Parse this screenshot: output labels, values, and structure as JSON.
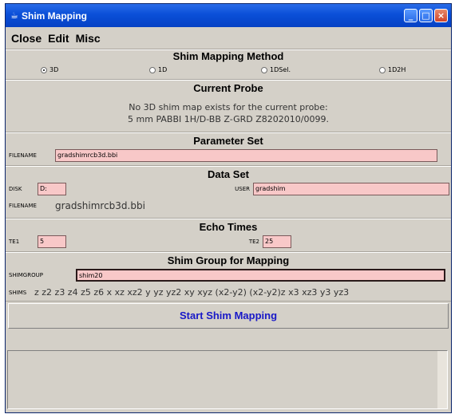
{
  "window": {
    "title": "Shim Mapping"
  },
  "menubar": {
    "items": [
      "Close",
      "Edit",
      "Misc"
    ]
  },
  "method": {
    "heading": "Shim Mapping Method",
    "options": [
      "3D",
      "1D",
      "1DSel.",
      "1D2H"
    ],
    "selected": "3D"
  },
  "probe": {
    "heading": "Current Probe",
    "line1": "No 3D shim map exists for the current probe:",
    "line2": "5 mm PABBI 1H/D-BB Z-GRD Z8202010/0099."
  },
  "parameter_set": {
    "heading": "Parameter Set",
    "filename_label": "FILENAME",
    "filename_value": "gradshimrcb3d.bbi"
  },
  "data_set": {
    "heading": "Data Set",
    "disk_label": "DISK",
    "disk_value": "D:",
    "user_label": "USER",
    "user_value": "gradshim",
    "filename_label": "FILENAME",
    "filename_value": "gradshimrcb3d.bbi"
  },
  "echo_times": {
    "heading": "Echo Times",
    "te1_label": "TE1",
    "te1_value": "5",
    "te2_label": "TE2",
    "te2_value": "25"
  },
  "shim_group": {
    "heading": "Shim Group for Mapping",
    "shimgroup_label": "SHIMGROUP",
    "shimgroup_value": "shim20",
    "shims_label": "SHIMS",
    "shims_value": "z z2 z3 z4 z5 z6 x xz xz2 y yz yz2 xy xyz (x2-y2) (x2-y2)z x3 xz3 y3 yz3"
  },
  "actions": {
    "start_label": "Start Shim Mapping"
  }
}
